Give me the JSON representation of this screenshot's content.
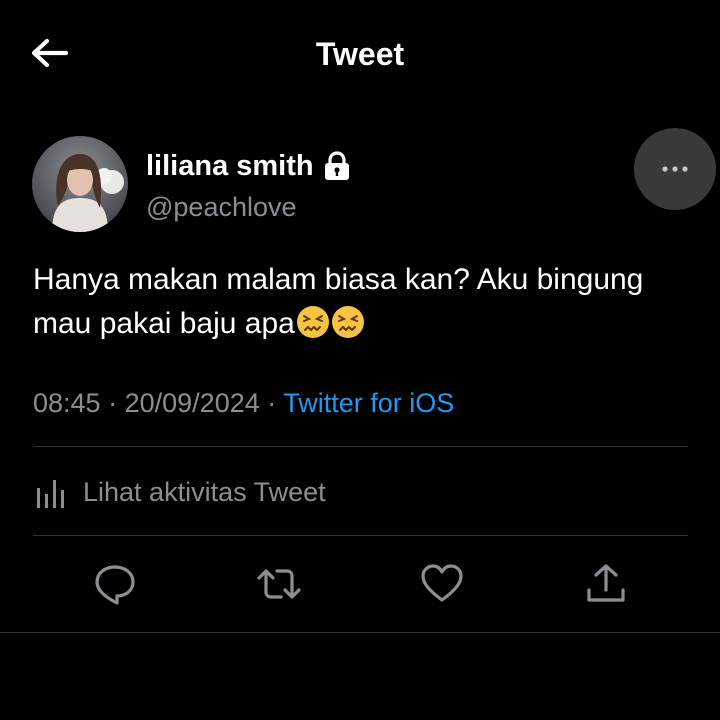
{
  "header": {
    "title": "Tweet",
    "back_icon": "arrow-left-icon"
  },
  "author": {
    "display_name": "liliana smith",
    "handle": "@peachlove",
    "protected_icon": "lock-icon",
    "avatar": "avatar"
  },
  "more_icon": "more-horizontal-icon",
  "tweet": {
    "text": "Hanya makan malam biasa kan? Aku bingung mau pakai baju apa",
    "emojis": [
      "confounded-face-emoji",
      "confounded-face-emoji"
    ]
  },
  "meta": {
    "time": "08:45",
    "separator": "·",
    "date": "20/09/2024",
    "source": "Twitter for iOS"
  },
  "activity": {
    "label": "Lihat aktivitas Tweet",
    "icon": "analytics-icon"
  },
  "actions": {
    "reply_icon": "reply-icon",
    "retweet_icon": "retweet-icon",
    "like_icon": "heart-icon",
    "share_icon": "share-icon"
  },
  "colors": {
    "background": "#000000",
    "link": "#1d9bf0",
    "secondary_text": "#8b8f94",
    "divider": "#2f3336"
  }
}
